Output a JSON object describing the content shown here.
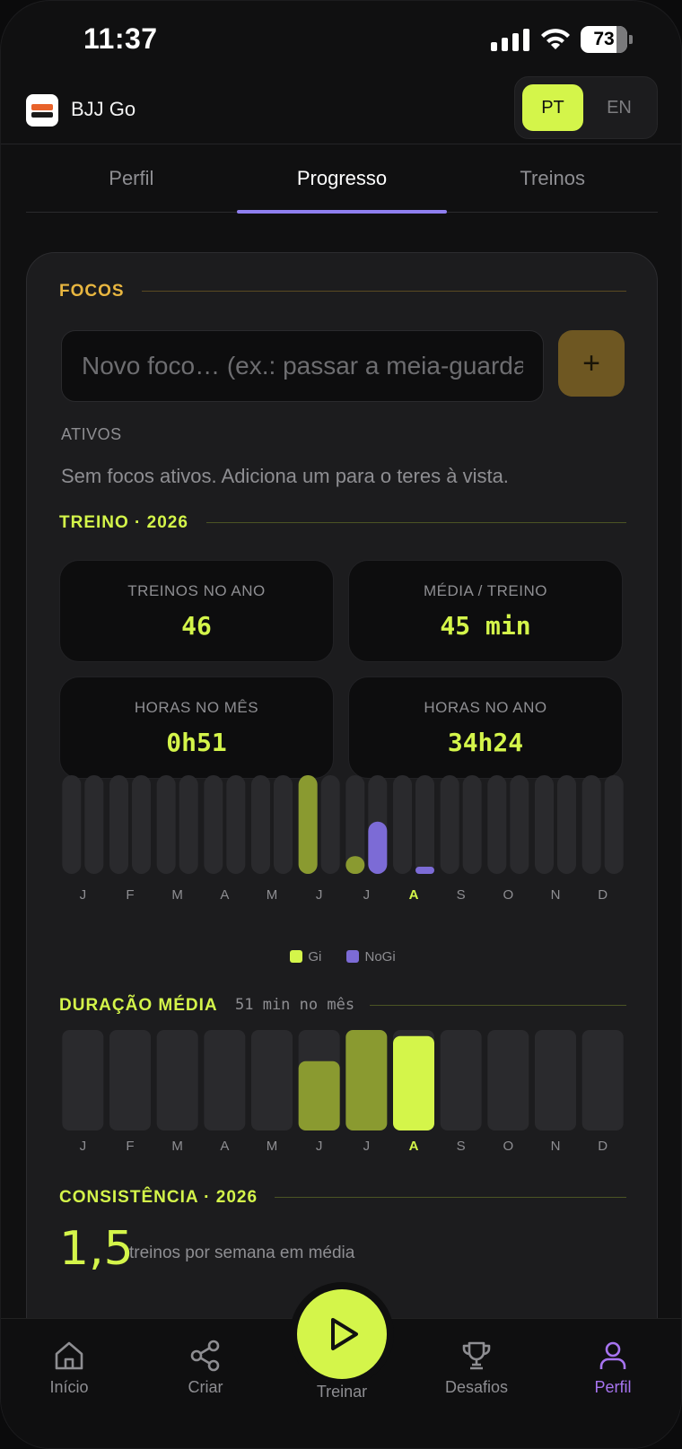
{
  "status_bar": {
    "time": "11:37",
    "battery": "73"
  },
  "header": {
    "app_name": "BJJ Go",
    "lang_options": [
      "PT",
      "EN"
    ],
    "lang_selected": "PT"
  },
  "tabs": [
    {
      "label": "Perfil",
      "active": false
    },
    {
      "label": "Progresso",
      "active": true
    },
    {
      "label": "Treinos",
      "active": false
    }
  ],
  "focos": {
    "title": "FOCOS",
    "input_placeholder": "Novo foco… (ex.: passar a meia-guarda)",
    "add_label": "+",
    "active_label": "ATIVOS",
    "empty_message": "Sem focos ativos. Adiciona um para o teres à vista."
  },
  "treino": {
    "title": "TREINO · 2026",
    "stats": [
      {
        "label": "TREINOS NO ANO",
        "value": "46"
      },
      {
        "label": "MÉDIA / TREINO",
        "value": "45 min"
      },
      {
        "label": "HORAS NO MÊS",
        "value": "0h51"
      },
      {
        "label": "HORAS NO ANO",
        "value": "34h24"
      }
    ]
  },
  "duracao": {
    "title": "DURAÇÃO MÉDIA",
    "subtitle": "51 min no mês"
  },
  "consistencia": {
    "title": "CONSISTÊNCIA · 2026",
    "value": "1,5",
    "subtitle": "treinos por semana em média"
  },
  "bottom_nav": {
    "items": [
      {
        "label": "Início",
        "icon": "home-icon",
        "active": false
      },
      {
        "label": "Criar",
        "icon": "share-icon",
        "active": false
      },
      {
        "label": "Desafios",
        "icon": "trophy-icon",
        "active": false
      },
      {
        "label": "Perfil",
        "icon": "user-icon",
        "active": true
      }
    ],
    "center_label": "Treinar"
  },
  "colors": {
    "lime": "#d4f54a",
    "olive": "#8a9a30",
    "purple": "#7c6bd6",
    "gold": "#e8b640",
    "track": "#2a2a2d"
  },
  "chart_data": [
    {
      "type": "bar",
      "categories": [
        "J",
        "F",
        "M",
        "A",
        "M",
        "J",
        "J",
        "A",
        "S",
        "O",
        "N",
        "D"
      ],
      "highlight_category_index": 7,
      "series": [
        {
          "name": "Gi",
          "values": [
            0,
            0,
            0,
            0,
            0,
            1.0,
            0.18,
            0,
            0,
            0,
            0,
            0
          ]
        },
        {
          "name": "NoGi",
          "values": [
            0,
            0,
            0,
            0,
            0,
            0,
            0.53,
            0.07,
            0,
            0,
            0,
            0
          ]
        }
      ],
      "ylim": [
        0,
        1
      ]
    },
    {
      "type": "bar",
      "categories": [
        "J",
        "F",
        "M",
        "A",
        "M",
        "J",
        "J",
        "A",
        "S",
        "O",
        "N",
        "D"
      ],
      "highlight_category_index": 7,
      "values": [
        0,
        0,
        0,
        0,
        0,
        0.69,
        1.0,
        0.94,
        0,
        0,
        0,
        0
      ],
      "ylim": [
        0,
        1
      ]
    }
  ]
}
